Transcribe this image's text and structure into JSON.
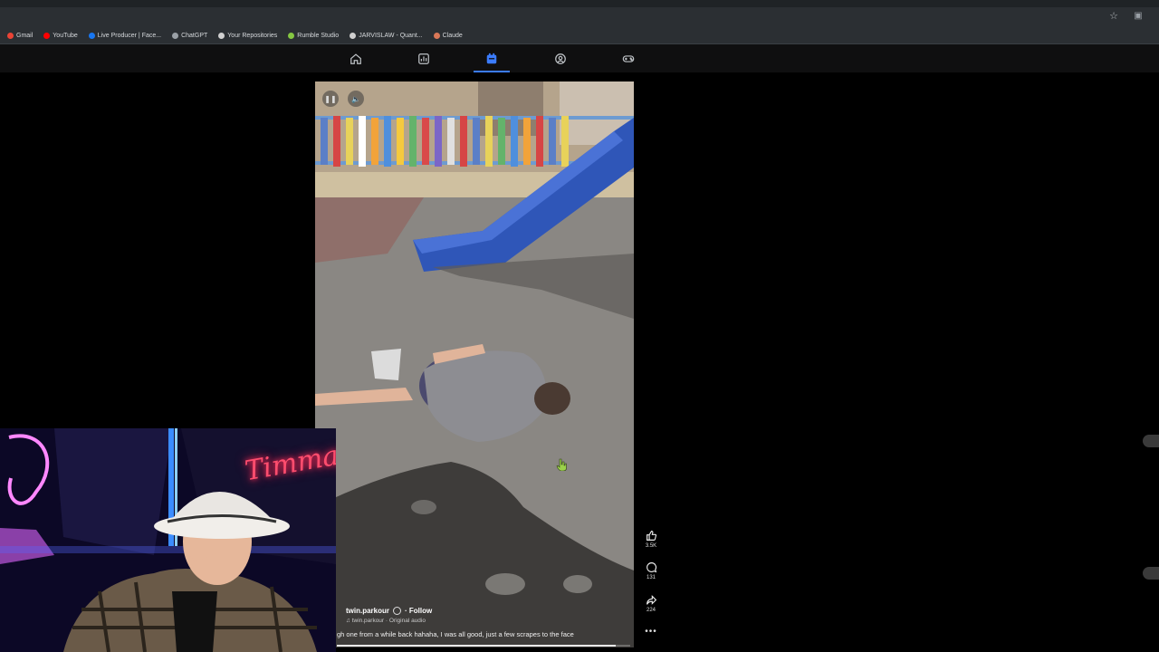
{
  "bookmarks": [
    {
      "label": "Gmail",
      "color": "#ea4335"
    },
    {
      "label": "YouTube",
      "color": "#ff0000"
    },
    {
      "label": "Live Producer | Face...",
      "color": "#1877f2"
    },
    {
      "label": "ChatGPT",
      "color": "#9aa0a6"
    },
    {
      "label": "Your Repositories",
      "color": "#d0d0d0"
    },
    {
      "label": "Rumble Studio",
      "color": "#85c742"
    },
    {
      "label": "JARVISLAW - Quant...",
      "color": "#cfcfcf"
    },
    {
      "label": "Claude",
      "color": "#d97757"
    }
  ],
  "nav": {
    "items": [
      {
        "icon": "home-icon",
        "active": false
      },
      {
        "icon": "explore-icon",
        "active": false
      },
      {
        "icon": "shorts-icon",
        "active": true
      },
      {
        "icon": "profile-icon",
        "active": false
      },
      {
        "icon": "gaming-icon",
        "active": false
      }
    ],
    "accent": "#3b7cff"
  },
  "video": {
    "author": "twin.parkour",
    "follow_label": "· Follow",
    "audio": "twin.parkour · Original audio",
    "description": "gh one from a while back hahaha, I was all good, just a few scrapes to the face",
    "progress": 0.95
  },
  "actions": {
    "likes": "3.5K",
    "comments": "131",
    "shares": "224"
  },
  "webcam": {
    "neon_sign": "Timmay"
  }
}
